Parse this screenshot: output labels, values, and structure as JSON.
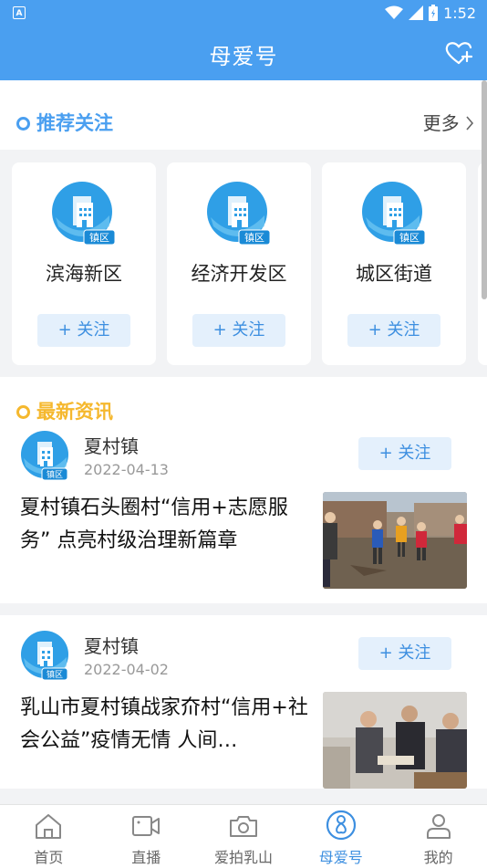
{
  "status": {
    "app_badge": "A",
    "time": "1:52"
  },
  "header": {
    "title": "母爱号"
  },
  "recommend": {
    "title": "推荐关注",
    "more": "更多",
    "cards": [
      {
        "name": "滨海新区",
        "badge": "镇区",
        "follow": "+ 关注"
      },
      {
        "name": "经济开发区",
        "badge": "镇区",
        "follow": "+ 关注"
      },
      {
        "name": "城区街道",
        "badge": "镇区",
        "follow": "+ 关注"
      }
    ]
  },
  "news": {
    "title": "最新资讯",
    "articles": [
      {
        "source": "夏村镇",
        "badge": "镇区",
        "date": "2022-04-13",
        "follow": "+ 关注",
        "headline": "夏村镇石头圈村“信用+志愿服务” 点亮村级治理新篇章"
      },
      {
        "source": "夏村镇",
        "badge": "镇区",
        "date": "2022-04-02",
        "follow": "+ 关注",
        "headline": "乳山市夏村镇战家夼村“信用+社会公益”疫情无情 人间…"
      }
    ]
  },
  "tabs": [
    {
      "label": "首页",
      "icon": "home-icon"
    },
    {
      "label": "直播",
      "icon": "video-icon"
    },
    {
      "label": "爱拍乳山",
      "icon": "camera-icon"
    },
    {
      "label": "母爱号",
      "icon": "mother-love-icon",
      "active": true
    },
    {
      "label": "我的",
      "icon": "user-icon"
    }
  ],
  "colors": {
    "primary": "#4a9ff0",
    "accent_blue": "#3d8fe0",
    "accent_gold": "#f5b82e"
  }
}
